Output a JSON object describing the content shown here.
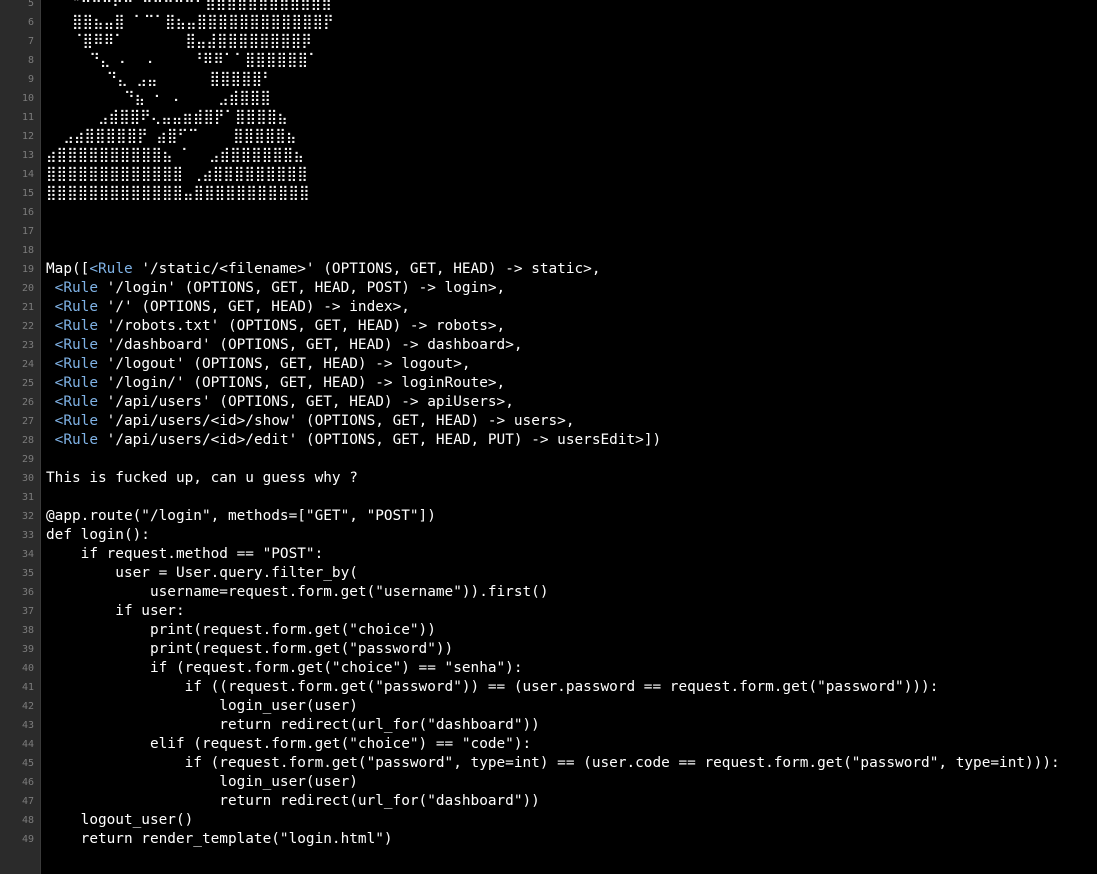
{
  "colors": {
    "background": "#000000",
    "gutter": "#2b2b2b",
    "line_number": "#7c7c7c",
    "text": "#ffffff",
    "tag": "#7fb2e5"
  },
  "gutter": {
    "line_numbers": [
      "5",
      "6",
      "7",
      "8",
      "9",
      "10",
      "11",
      "12",
      "13",
      "14",
      "15",
      "16",
      "17",
      "18",
      "19",
      "20",
      "21",
      "22",
      "23",
      "24",
      "25",
      "26",
      "27",
      "28",
      "29",
      "30",
      "31",
      "32",
      "33",
      "34",
      "35",
      "36",
      "37",
      "38",
      "39",
      "40",
      "41",
      "42",
      "43",
      "44",
      "45",
      "46",
      "47",
      "48",
      "49"
    ]
  },
  "ascii_art": {
    "lines": [
      "   \"⠛⠛⠛⠟⠛ ⠛⠛⠛⠛⠛⠋⣿⣿⣿⣿⣿⣿⣿⣿⣿⣿⣿⣿",
      "   ⣿⣿⣦⣤⣿ ⠁⠉⠁⣿⣦⣤⣿⣿⣿⣿⣿⣿⣿⣿⣿⣿⣿⣿⡟",
      "   ⠈⣿⠿⠿⠁       ⣿⣤⣼⣿⣿⣿⣿⣿⣿⣿⣿⡿",
      "     ⠙⣄ ⠄  ⠄    ⠘⠿⠿⠁⠁⣿⣿⣿⣿⣿⣿⠁",
      "       ⠙⣄ ⣠⣤      ⣿⣿⣿⣿⣿⠃",
      "         ⠙⣦ ⠂ ⠄    ⣠⣾⣿⣿⣿",
      "      ⣠⣾⣿⣿⠟⢄⣤⣤⣶⣾⣿⡟⠁⣿⣿⣿⣿⣦",
      "  ⣠⣴⣿⣿⣿⣿⣿⡟ ⣴⣿⠋⠉    ⣿⣿⣿⣿⣿⣦",
      "⣴⣿⣿⣿⣿⣿⣿⣿⣿⣿⣿⣦ ⠁  ⣠⣾⣿⣿⣿⣿⣿⣿⣦",
      "⣿⣿⣿⣿⣿⣿⣿⣿⣿⣿⣿⣿⣿ ⢀⣴⣿⣿⣿⣿⣿⣿⣿⣿⣿",
      "⣿⣿⣿⣿⣿⣿⣿⣿⣿⣿⣿⣿⣿⣤⣿⣿⣿⣿⣿⣿⣿⣿⣿⣿⣿"
    ]
  },
  "code": {
    "routes_map": [
      [
        "Map([",
        "<Rule",
        " '/static/<filename>' (OPTIONS, GET, HEAD) -> static>,"
      ],
      [
        " ",
        "<Rule",
        " '/login' (OPTIONS, GET, HEAD, POST) -> login>,"
      ],
      [
        " ",
        "<Rule",
        " '/' (OPTIONS, GET, HEAD) -> index>,"
      ],
      [
        " ",
        "<Rule",
        " '/robots.txt' (OPTIONS, GET, HEAD) -> robots>,"
      ],
      [
        " ",
        "<Rule",
        " '/dashboard' (OPTIONS, GET, HEAD) -> dashboard>,"
      ],
      [
        " ",
        "<Rule",
        " '/logout' (OPTIONS, GET, HEAD) -> logout>,"
      ],
      [
        " ",
        "<Rule",
        " '/login/' (OPTIONS, GET, HEAD) -> loginRoute>,"
      ],
      [
        " ",
        "<Rule",
        " '/api/users' (OPTIONS, GET, HEAD) -> apiUsers>,"
      ],
      [
        " ",
        "<Rule",
        " '/api/users/<id>/show' (OPTIONS, GET, HEAD) -> users>,"
      ],
      [
        " ",
        "<Rule",
        " '/api/users/<id>/edit' (OPTIONS, GET, HEAD, PUT) -> usersEdit>])"
      ]
    ],
    "comment_line": "This is fucked up, can u guess why ?",
    "python_lines": [
      "@app.route(\"/login\", methods=[\"GET\", \"POST\"])",
      "def login():",
      "    if request.method == \"POST\":",
      "        user = User.query.filter_by(",
      "            username=request.form.get(\"username\")).first()",
      "        if user:",
      "            print(request.form.get(\"choice\"))",
      "            print(request.form.get(\"password\"))",
      "            if (request.form.get(\"choice\") == \"senha\"):",
      "                if ((request.form.get(\"password\")) == (user.password == request.form.get(\"password\"))):",
      "                    login_user(user)",
      "                    return redirect(url_for(\"dashboard\"))",
      "            elif (request.form.get(\"choice\") == \"code\"):",
      "                if (request.form.get(\"password\", type=int) == (user.code == request.form.get(\"password\", type=int))):",
      "                    login_user(user)",
      "                    return redirect(url_for(\"dashboard\"))",
      "    logout_user()",
      "    return render_template(\"login.html\")"
    ]
  }
}
